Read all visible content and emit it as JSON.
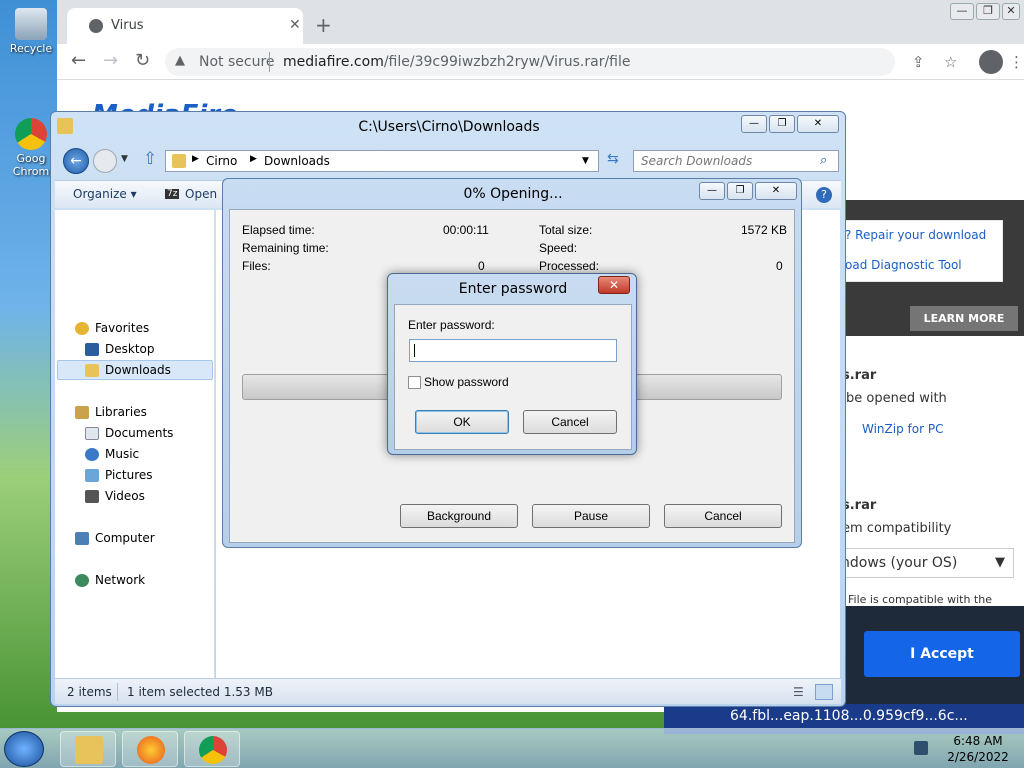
{
  "desktop": {
    "icons": [
      {
        "label": "Recycle",
        "name": "recycle-bin-icon"
      },
      {
        "label": "Goog Chrom",
        "name": "chrome-desktop-icon"
      }
    ]
  },
  "chrome": {
    "tab_title": "Virus",
    "tab_close": "✕",
    "new_tab": "+",
    "security_label": "Not secure",
    "url_domain": "mediafire.com",
    "url_path": "/file/39c99iwzbzh2ryw/Virus.rar/file",
    "back": "←",
    "forward": "→",
    "reload": "↻",
    "min": "—",
    "max": "❐",
    "close": "✕"
  },
  "mediafire": {
    "logo": "MediaFire",
    "repair_link": "? Repair your download",
    "diag_link": "oad Diagnostic Tool",
    "learn_more": "LEARN MORE",
    "file1_name": "s.rar",
    "file1_desc": "be opened with",
    "winzip": "WinZip for PC",
    "file2_name": "s.rar",
    "file2_desc": "em compatibility",
    "os_value": "ndows (your OS)",
    "compat_note": "File is compatible with the",
    "accept": "I Accept",
    "bottom_text": "64.fbl...eap.1108...0.959cf9...6c..."
  },
  "explorer": {
    "title": "C:\\Users\\Cirno\\Downloads",
    "crumb1": "Cirno",
    "crumb2": "Downloads",
    "search_placeholder": "Search Downloads",
    "organize": "Organize ▾",
    "open": "Open",
    "tree": {
      "favorites": "Favorites",
      "desktop": "Desktop",
      "downloads": "Downloads",
      "libraries": "Libraries",
      "documents": "Documents",
      "music": "Music",
      "pictures": "Pictures",
      "videos": "Videos",
      "computer": "Computer",
      "network": "Network"
    },
    "status_items": "2 items",
    "status_selected": "1 item selected  1.53 MB"
  },
  "progress": {
    "title": "0% Opening...",
    "elapsed_label": "Elapsed time:",
    "elapsed_value": "00:00:11",
    "remaining_label": "Remaining time:",
    "files_label": "Files:",
    "files_value": "0",
    "total_label": "Total size:",
    "total_value": "1572 KB",
    "speed_label": "Speed:",
    "processed_label": "Processed:",
    "processed_value": "0",
    "background": "Background",
    "pause": "Pause",
    "cancel": "Cancel"
  },
  "password": {
    "title": "Enter password",
    "close": "✕",
    "field_label": "Enter password:",
    "value": "",
    "show_label": "Show password",
    "ok": "OK",
    "cancel": "Cancel"
  },
  "taskbar": {
    "time": "6:48 AM",
    "date": "2/26/2022"
  }
}
